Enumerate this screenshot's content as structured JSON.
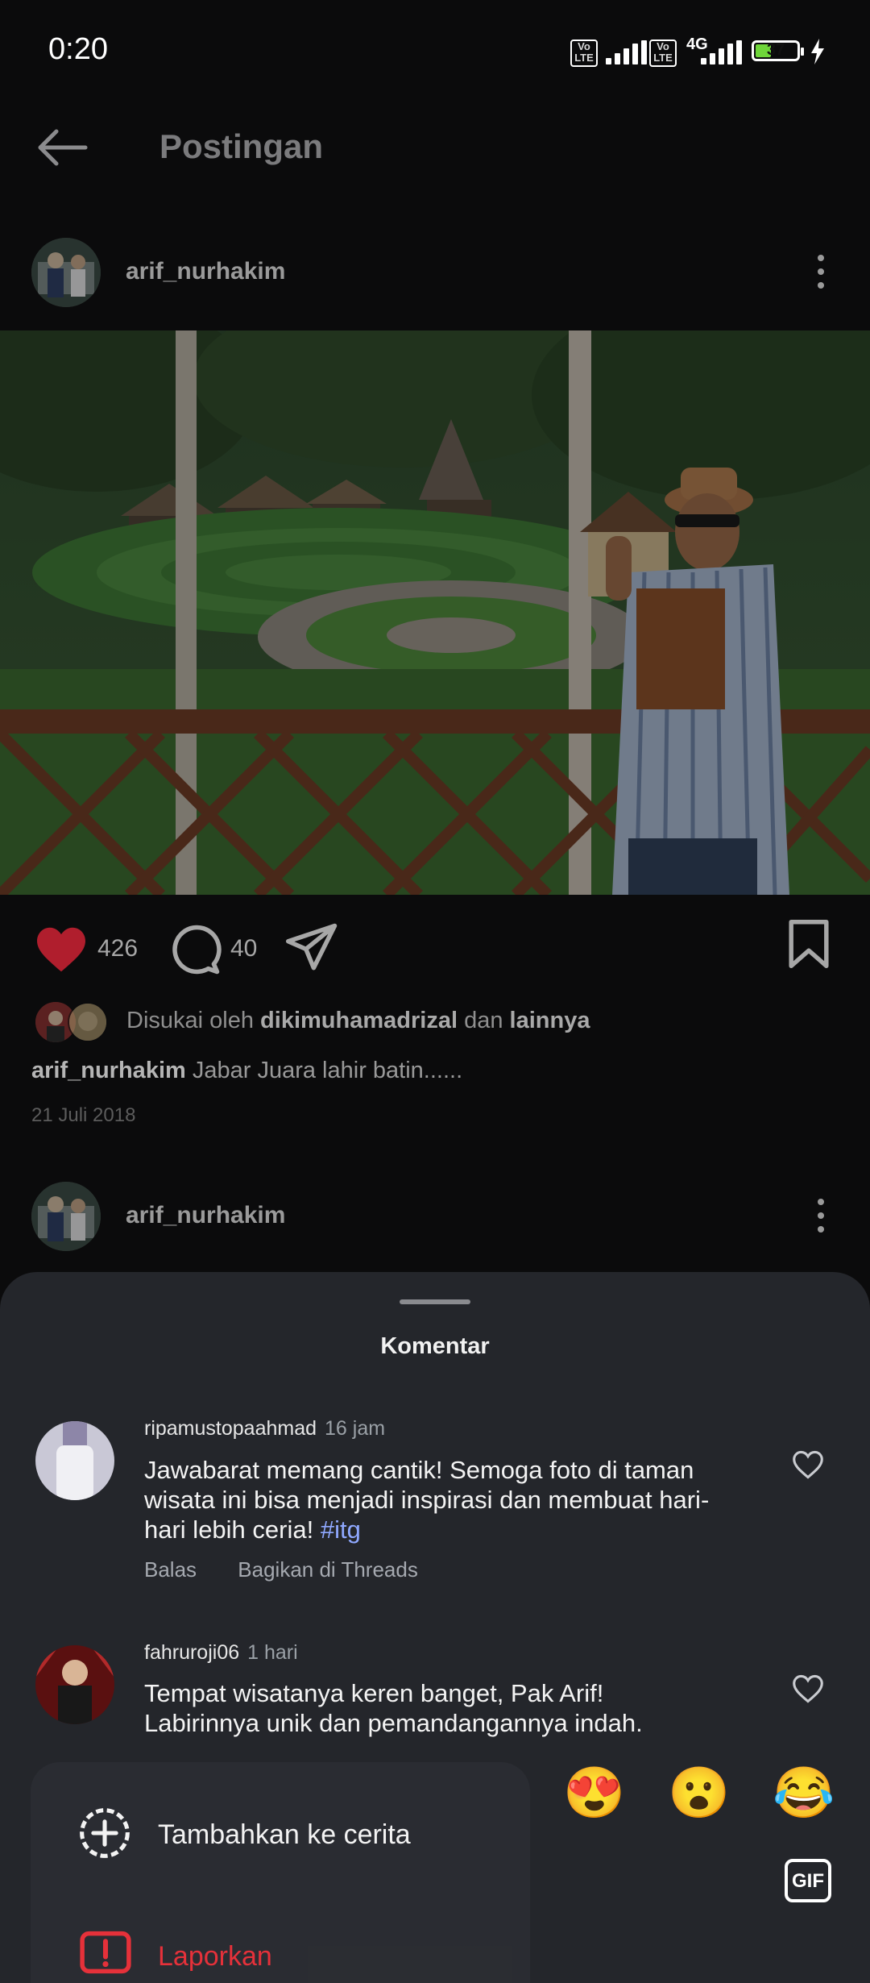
{
  "status_bar": {
    "time": "0:20",
    "sim1_badge": "Vo LTE",
    "sim2_badge": "Vo LTE",
    "network": "4G",
    "battery_level": "37",
    "battery_fraction": 0.37,
    "charging_icon": "lightning-bolt-icon"
  },
  "header": {
    "back_icon": "arrow-left-icon",
    "title": "Postingan"
  },
  "post1": {
    "username": "arif_nurhakim",
    "menu_icon": "more-vertical-icon",
    "like_count": "426",
    "comment_count": "40",
    "liked": true,
    "likes_prefix": "Disukai oleh",
    "likes_user": "dikimuhamadrizal",
    "likes_conj": "dan",
    "likes_rest": "lainnya",
    "caption_user": "arif_nurhakim",
    "caption_text": "Jabar Juara lahir batin......",
    "date": "21 Juli 2018"
  },
  "post2": {
    "username": "arif_nurhakim"
  },
  "comments_sheet": {
    "title": "Komentar",
    "comments": [
      {
        "user": "ripamustopaahmad",
        "time": "16 jam",
        "text": "Jawabarat memang cantik!  Semoga foto di taman wisata ini bisa menjadi inspirasi dan membuat hari-hari lebih ceria!",
        "hashtag": "#itg",
        "reply": "Balas",
        "share": "Bagikan di Threads"
      },
      {
        "user": "fahruroji06",
        "time": "1 hari",
        "text": "Tempat wisatanya keren banget, Pak Arif!  Labirinnya unik dan pemandangannya indah.  Semoga liburan"
      }
    ]
  },
  "popup_menu": {
    "add_to_story": "Tambahkan ke cerita",
    "report": "Laporkan"
  },
  "reactions": [
    "😍",
    "😮",
    "😂"
  ],
  "gif_label": "GIF",
  "colors": {
    "like_red": "#e0243a",
    "report_red": "#e5313a",
    "hashtag_blue": "#8fa8ff",
    "sheet_bg": "#24262b"
  }
}
